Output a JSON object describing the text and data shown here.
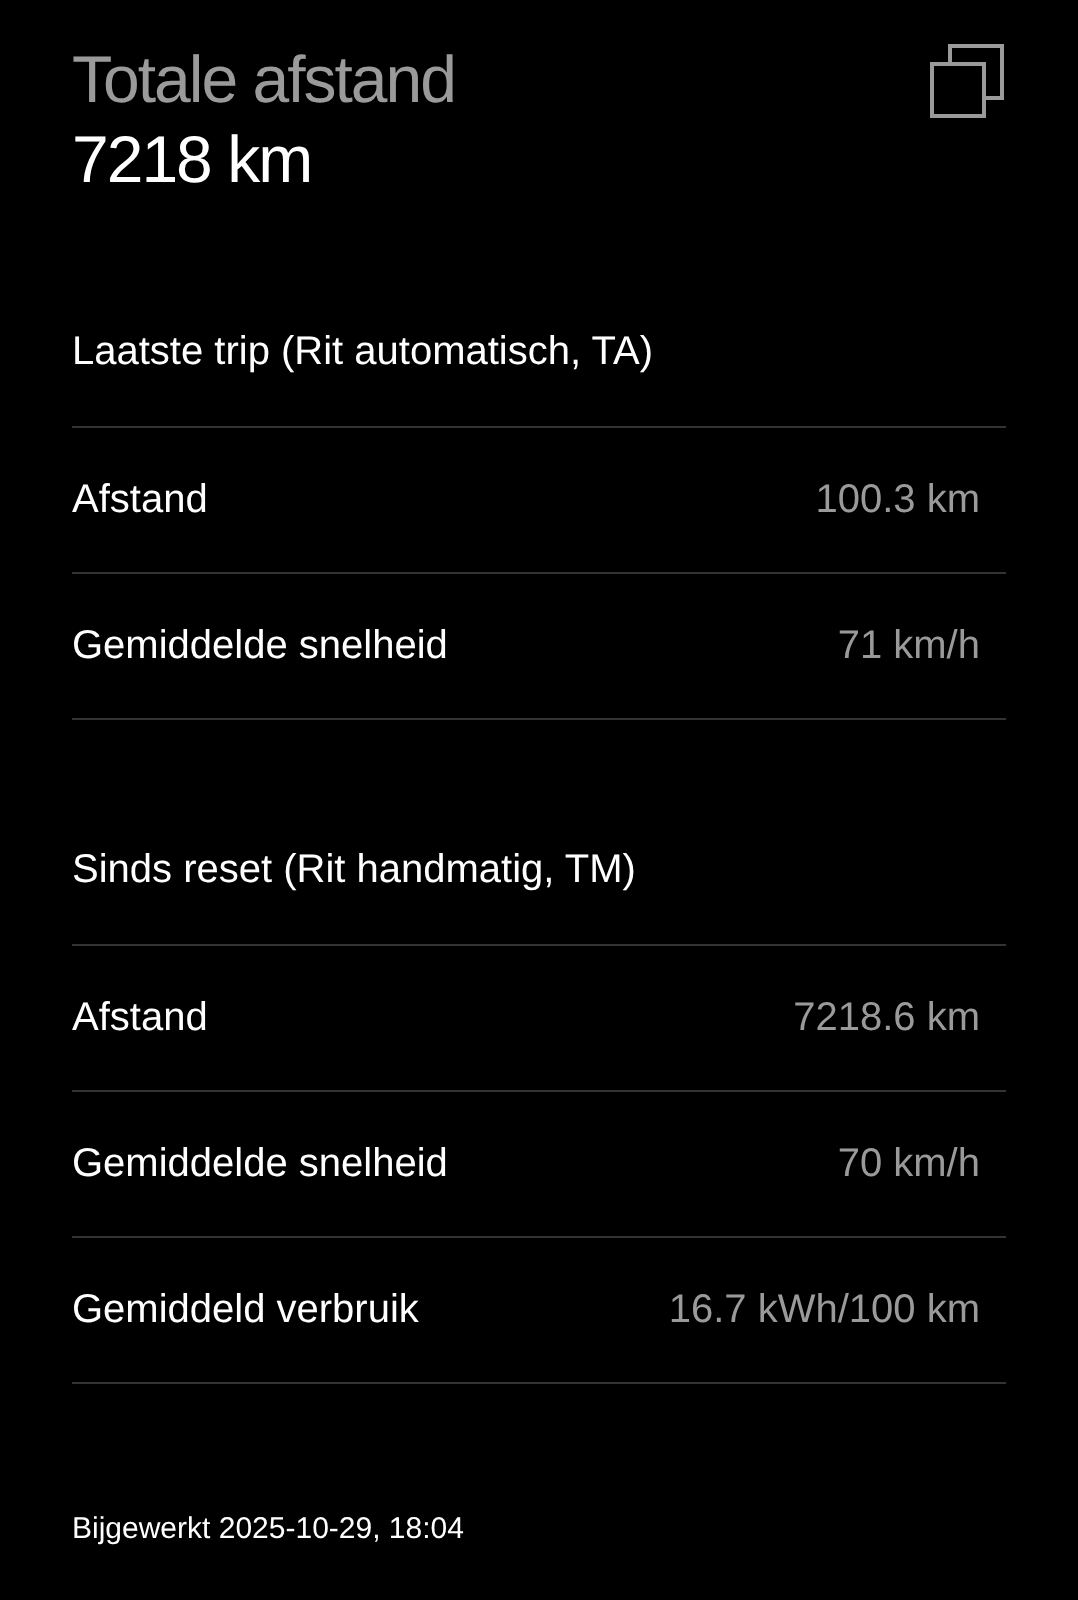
{
  "header": {
    "title": "Totale afstand",
    "value": "7218 km"
  },
  "sections": [
    {
      "title": "Laatste trip (Rit automatisch, TA)",
      "rows": [
        {
          "label": "Afstand",
          "value": "100.3 km"
        },
        {
          "label": "Gemiddelde snelheid",
          "value": "71 km/h"
        }
      ]
    },
    {
      "title": "Sinds reset (Rit handmatig, TM)",
      "rows": [
        {
          "label": "Afstand",
          "value": "7218.6 km"
        },
        {
          "label": "Gemiddelde snelheid",
          "value": "70 km/h"
        },
        {
          "label": "Gemiddeld verbruik",
          "value": "16.7 kWh/100 km"
        }
      ]
    }
  ],
  "footer": "Bijgewerkt 2025-10-29, 18:04"
}
